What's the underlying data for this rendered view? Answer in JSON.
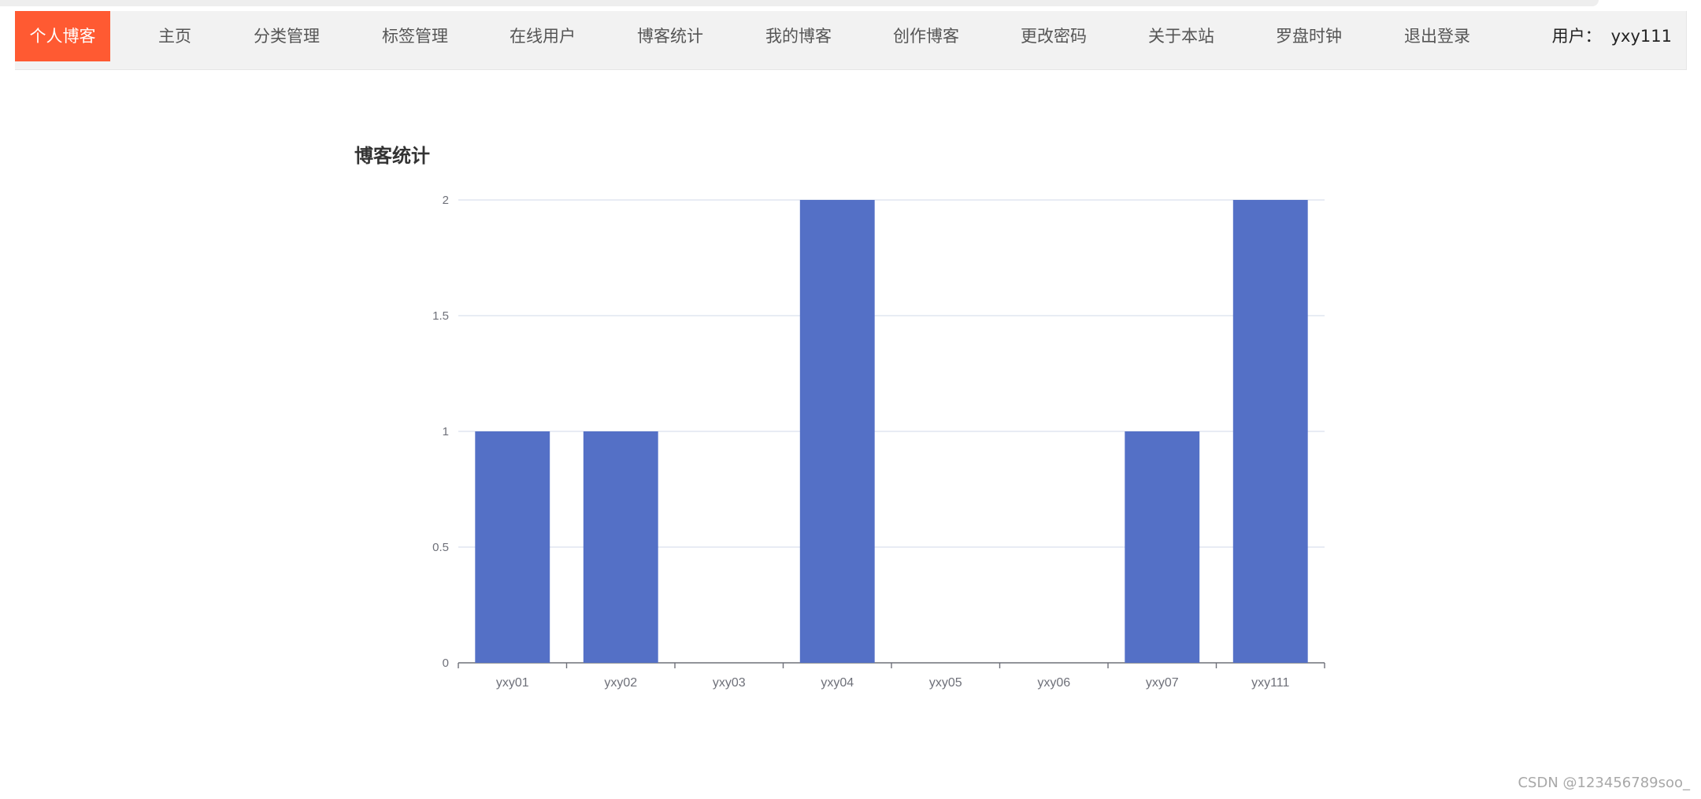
{
  "nav": {
    "brand": "个人博客",
    "items": [
      {
        "label": "主页",
        "name": "nav-item-home"
      },
      {
        "label": "分类管理",
        "name": "nav-item-category-management"
      },
      {
        "label": "标签管理",
        "name": "nav-item-tag-management"
      },
      {
        "label": "在线用户",
        "name": "nav-item-online-users"
      },
      {
        "label": "博客统计",
        "name": "nav-item-blog-statistics"
      },
      {
        "label": "我的博客",
        "name": "nav-item-my-blog"
      },
      {
        "label": "创作博客",
        "name": "nav-item-create-blog"
      },
      {
        "label": "更改密码",
        "name": "nav-item-change-password"
      },
      {
        "label": "关于本站",
        "name": "nav-item-about-site"
      },
      {
        "label": "罗盘时钟",
        "name": "nav-item-compass-clock"
      },
      {
        "label": "退出登录",
        "name": "nav-item-logout"
      }
    ],
    "user_label": "用户：",
    "user_name": "yxy111"
  },
  "chart_data": {
    "type": "bar",
    "title": "博客统计",
    "categories": [
      "yxy01",
      "yxy02",
      "yxy03",
      "yxy04",
      "yxy05",
      "yxy06",
      "yxy07",
      "yxy111"
    ],
    "values": [
      1,
      1,
      0,
      2,
      0,
      0,
      1,
      2
    ],
    "ylim": [
      0,
      2
    ],
    "yticks": [
      "0",
      "0.5",
      "1",
      "1.5",
      "2"
    ],
    "xlabel": "",
    "ylabel": "",
    "grid": true,
    "bar_color": "#5470c6"
  },
  "watermark": "CSDN @123456789soo_"
}
